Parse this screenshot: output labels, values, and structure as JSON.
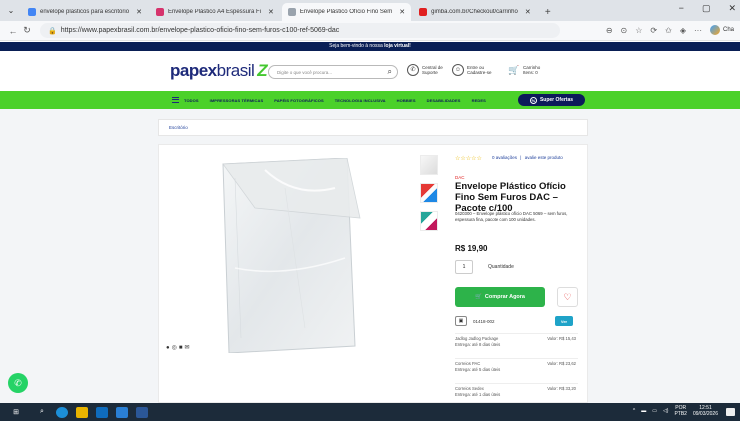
{
  "browser": {
    "tabs": [
      {
        "title": "envelope plasticos para escritorio",
        "favicon_color": "#4285f4",
        "active": false
      },
      {
        "title": "Envelope Plástico A4 Espessura Fi",
        "favicon_color": "#d6336c",
        "active": false
      },
      {
        "title": "Envelope Plástico Ofício Fino Sem",
        "favicon_color": "#7a7a7a",
        "active": true
      },
      {
        "title": "gimba.com.br/Checkout/carrinho",
        "favicon_color": "#e02020",
        "active": false
      }
    ],
    "new_tab": "+",
    "url": "https://www.papexbrasil.com.br/envelope-plastico-oficio-fino-sem-furos-c100-ref-5069-dac",
    "window_controls": {
      "minimize": "−",
      "maximize": "▢",
      "close": "✕"
    },
    "copilot_label": "Cha"
  },
  "site": {
    "notice_prefix": "Seja bem-vindo à nossa",
    "notice_bold": "loja virtual!",
    "logo": {
      "papex": "papex",
      "brasil": "brasil"
    },
    "search_placeholder": "Digite o que você procura...",
    "header": {
      "support_line1": "Central de",
      "support_line2": "Suporte",
      "account_line1": "Entre ou",
      "account_line2": "Cadastre-se",
      "cart_line1": "Carrinho",
      "cart_line2": "Itens: 0"
    },
    "nav": [
      "TODOS",
      "IMPRESSORAS TÉRMICAS",
      "PAPÉIS FOTOGRÁFICOS",
      "TECNOLOGIA INCLUSIVA",
      "HOBBIES",
      "DESABILIDADES",
      "REDES"
    ],
    "super_offers": "Super Ofertas",
    "breadcrumb": "Escritório"
  },
  "product": {
    "reviews": "0 avaliações",
    "review_separator": "|",
    "review_link": "avalie este produto",
    "rating": 0,
    "brand": "DAC",
    "title": "Envelope Plástico Ofício Fino Sem Furos DAC – Pacote c/100",
    "description": "0420300 – Envelope plástico ofício DAC 5069 – sem furos, espessura fina, pacote com 100 unidades.",
    "price": "R$ 19,90",
    "qty_value": "1",
    "qty_label": "Quantidade",
    "buy_label": "Comprar Agora",
    "cep": "01418-002",
    "ver_label": "Ver",
    "shipping": [
      {
        "name": "Jadlog Jadlog Package",
        "eta": "Entrega: até 8 dias úteis",
        "value": "Valor: R$ 15,43"
      },
      {
        "name": "Correios PAC",
        "eta": "Entrega: até 5 dias úteis",
        "value": "Valor: R$ 23,62"
      },
      {
        "name": "Correios Sedex",
        "eta": "Entrega: até 1 dias úteis",
        "value": "Valor: R$ 33,20"
      }
    ]
  },
  "taskbar": {
    "lang": "POR",
    "lang2": "PTB2",
    "time": "12:51",
    "date": "09/03/2026"
  }
}
